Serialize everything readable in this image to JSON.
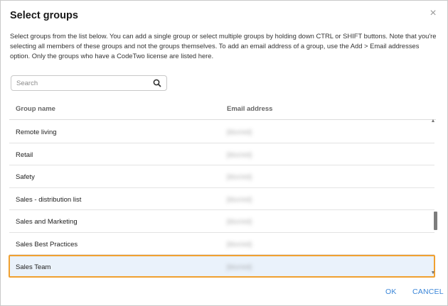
{
  "dialog": {
    "title": "Select groups",
    "close_glyph": "×",
    "description": "Select groups from the list below. You can add a single group or select multiple groups by holding down CTRL or SHIFT buttons. Note that you're selecting all members of these groups and not the groups themselves. To add an email address of a group, use the Add > Email addresses option. Only the groups who have a CodeTwo license are listed here."
  },
  "search": {
    "placeholder": "Search",
    "value": "",
    "icon": "search-icon"
  },
  "table": {
    "columns": [
      "Group name",
      "Email address"
    ],
    "rows": [
      {
        "name": "Remote living",
        "email": "[blurred]",
        "selected": false
      },
      {
        "name": "Retail",
        "email": "[blurred]",
        "selected": false
      },
      {
        "name": "Safety",
        "email": "[blurred]",
        "selected": false
      },
      {
        "name": "Sales - distribution list",
        "email": "[blurred]",
        "selected": false
      },
      {
        "name": "Sales and Marketing",
        "email": "[blurred]",
        "selected": false
      },
      {
        "name": "Sales Best Practices",
        "email": "[blurred]",
        "selected": false
      },
      {
        "name": "Sales Team",
        "email": "[blurred]",
        "selected": true
      }
    ],
    "scroll_position": 0.6,
    "scroll_up_glyph": "▲",
    "scroll_down_glyph": "▼"
  },
  "buttons": {
    "ok_label": "OK",
    "cancel_label": "CANCEL"
  },
  "colors": {
    "accent": "#3b86d8",
    "selection_border": "#f0a030",
    "selection_bg": "#eaf2fb"
  }
}
